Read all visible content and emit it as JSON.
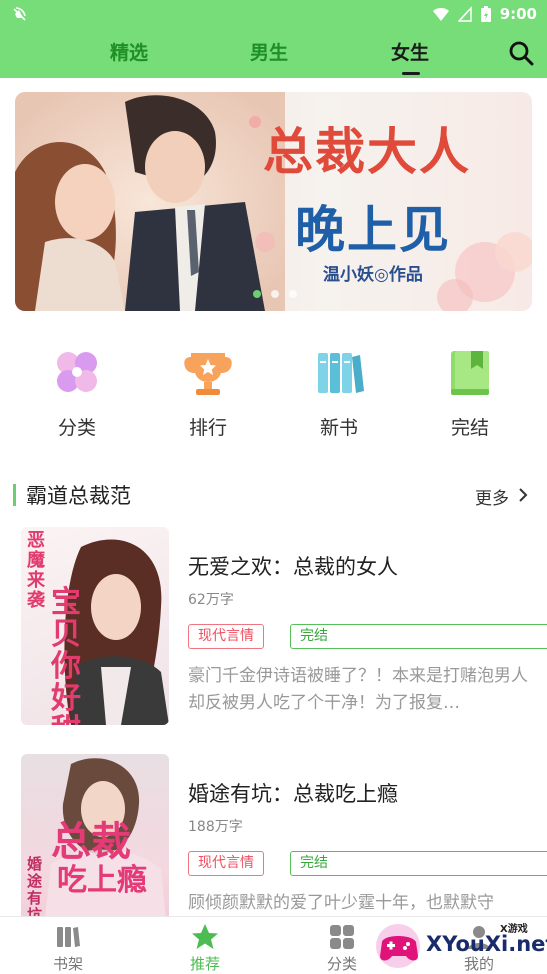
{
  "status_bar": {
    "time": "9:00"
  },
  "top_tabs": [
    {
      "label": "精选",
      "active": false
    },
    {
      "label": "男生",
      "active": false
    },
    {
      "label": "女生",
      "active": true
    }
  ],
  "banner": {
    "title_line1": "总裁大人",
    "title_line2": "晚上见",
    "author": "温小妖◎作品",
    "slide_count": 3,
    "active_slide": 1
  },
  "quick_links": [
    {
      "label": "分类",
      "icon": "clover-icon"
    },
    {
      "label": "排行",
      "icon": "trophy-icon"
    },
    {
      "label": "新书",
      "icon": "books-icon"
    },
    {
      "label": "完结",
      "icon": "bookmark-book-icon"
    }
  ],
  "section": {
    "title": "霸道总裁范",
    "more_label": "更多"
  },
  "books": [
    {
      "title": "无爱之欢：总裁的女人",
      "words": "62万字",
      "genre": "现代言情",
      "status": "完结",
      "desc": "豪门千金伊诗语被睡了？！本来是打赌泡男人却反被男人吃了个干净！为了报复…",
      "cover_text": [
        "恶魔来袭",
        "宝贝你好甜"
      ]
    },
    {
      "title": "婚途有坑：总裁吃上瘾",
      "words": "188万字",
      "genre": "现代言情",
      "status": "完结",
      "desc": "顾倾颜默默的爱了叶少霆十年，也默默守",
      "cover_text": [
        "总裁",
        "吃上瘾",
        "婚途有坑"
      ]
    }
  ],
  "bottom_nav": [
    {
      "label": "书架",
      "active": false
    },
    {
      "label": "推荐",
      "active": true
    },
    {
      "label": "分类",
      "active": false
    },
    {
      "label": "我的",
      "active": false
    }
  ],
  "watermark": {
    "brand": "XYouXi.net",
    "small": "X游戏"
  },
  "colors": {
    "accent": "#76dd78",
    "genre_tag": "#ef4f5f",
    "status_tag": "#36a93a"
  }
}
